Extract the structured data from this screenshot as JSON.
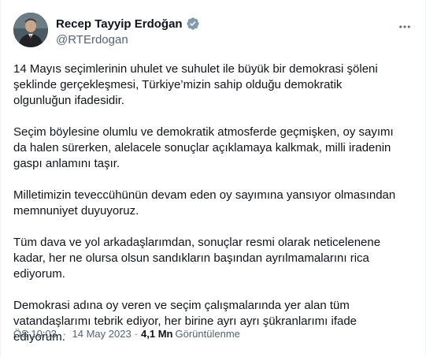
{
  "author": {
    "display_name": "Recep Tayyip Erdoğan",
    "handle": "@RTErdogan",
    "verified_icon": "verified-badge-icon",
    "verified_color": "#829aab"
  },
  "menu_icon": "more-horizontal-icon",
  "tweet": {
    "paragraphs": [
      "14 Mayıs seçimlerinin uhulet ve suhulet ile büyük bir demokrasi şöleni\nşeklinde gerçekleşmesi, Türkiye’mizin sahip olduğu demokratik\nolgunluğun ifadesidir.",
      "Seçim böylesine olumlu ve demokratik atmosferde geçmişken, oy sayımı\nda halen sürerken, alelacele sonuçlar açıklamaya kalkmak, milli iradenin\ngaspı anlamını taşır.",
      "Milletimizin teveccühünün devam eden oy sayımına yansıyor olmasından\nmemnuniyet duyuyoruz.",
      "Tüm dava ve yol arkadaşlarımdan, sonuçlar resmi olarak neticelenene\nkadar, her ne olursa olsun sandıkların başından ayrılmamalarını rica\nediyorum.",
      "Demokrasi adına oy veren ve seçim çalışmalarında yer alan tüm\nvatandaşlarımı tebrik ediyor, her birine ayrı ayrı şükranlarımı ifade\nediyorum."
    ]
  },
  "meta": {
    "time": "ÖS 10:03",
    "separator": "·",
    "date": "14 May 2023",
    "views_count": "4,1 Mn",
    "views_label": "Görüntülenme"
  }
}
